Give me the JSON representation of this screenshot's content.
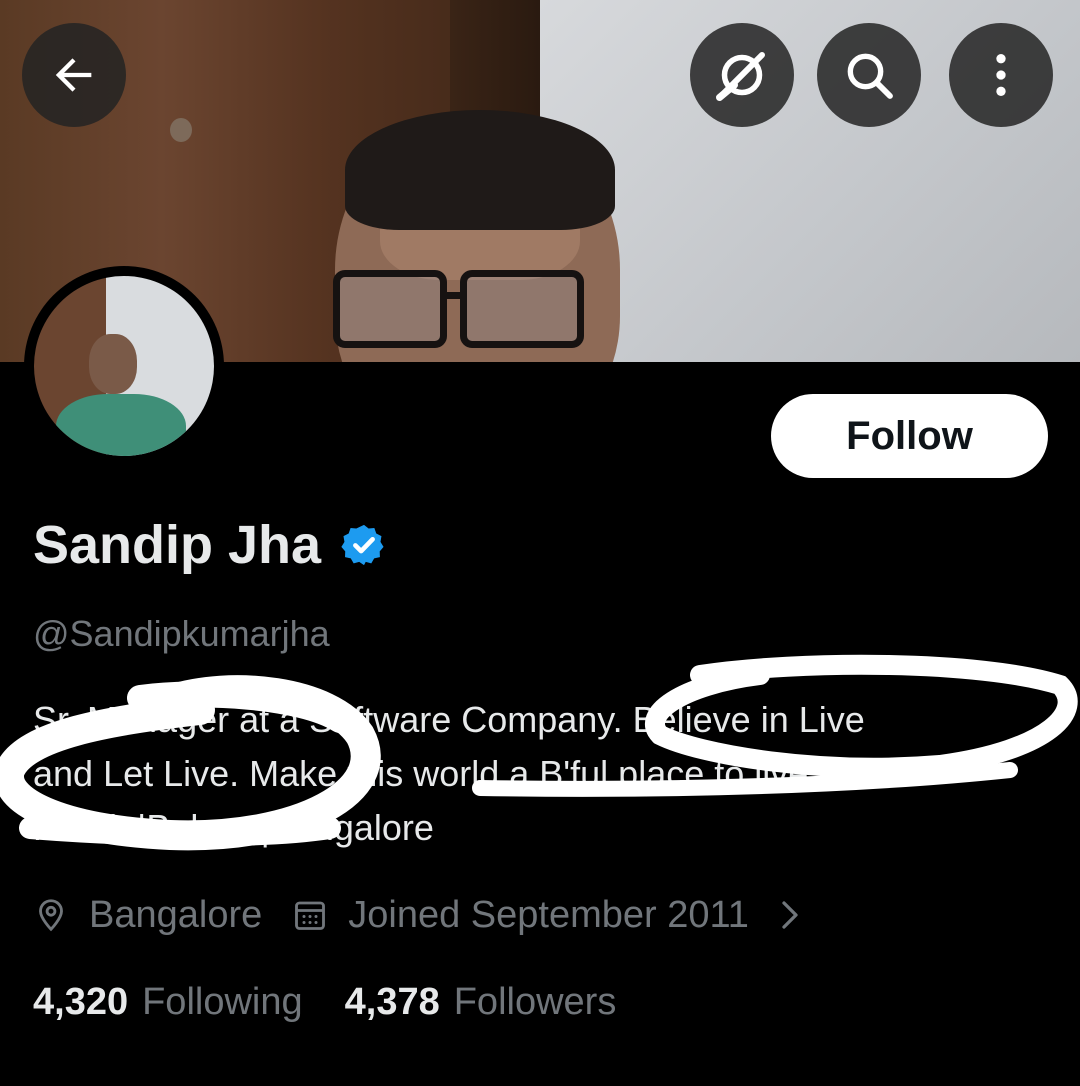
{
  "profile": {
    "name": "Sandip Jha",
    "handle": "@Sandipkumarjha",
    "verified_color": "#1d9bf0",
    "bio_lines": [
      "Sr. Manager at a Software  Company. Believe in Live",
      "and Let Live. Make this world a B'ful place to live in.",
      "Mithila|Bokaro|Bangalore"
    ],
    "location": "Bangalore",
    "joined": "Joined September 2011",
    "following_count": "4,320",
    "following_label": "Following",
    "followers_count": "4,378",
    "followers_label": "Followers"
  },
  "actions": {
    "follow_label": "Follow"
  },
  "icons": {
    "back": "arrow-left-icon",
    "grok": "grok-icon",
    "search": "search-icon",
    "more": "more-vertical-icon",
    "location": "location-pin-icon",
    "calendar": "calendar-icon",
    "chevron": "chevron-right-icon"
  },
  "colors": {
    "background": "#000000",
    "primary_text": "#e7e9ea",
    "secondary_text": "#71767b",
    "accent": "#1d9bf0"
  }
}
